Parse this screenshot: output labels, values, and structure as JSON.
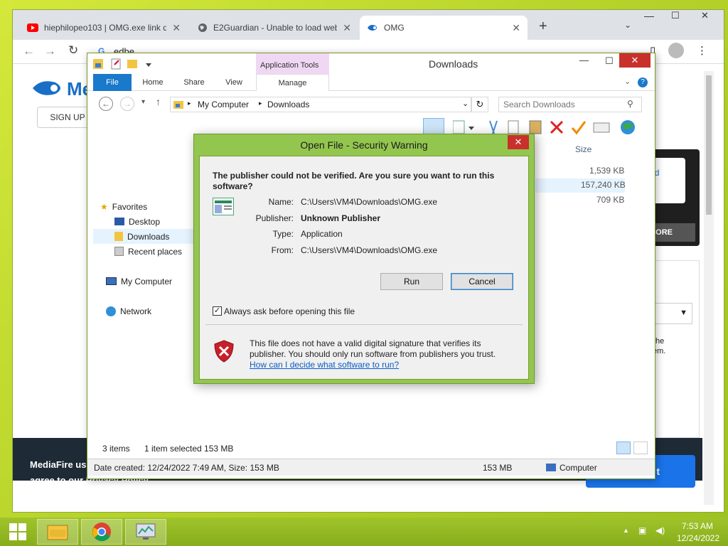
{
  "browser": {
    "tabs": [
      {
        "label": "hiephilopeo103 | OMG.exe link d",
        "icon": "youtube-icon"
      },
      {
        "label": "E2Guardian - Unable to load web",
        "icon": "globe-icon"
      },
      {
        "label": "OMG",
        "icon": "mediafire-icon"
      }
    ],
    "address": "edbe",
    "page": {
      "logo": "Me",
      "signup": "SIGN UP",
      "download_partial": "nload",
      "more_partial": "N MORE",
      "side_text_1": "he",
      "side_text_2": "em.",
      "cookie_text_1": "MediaFire use",
      "cookie_text_2": "agree to our Privacy Policy.",
      "cta_partial": "t"
    }
  },
  "explorer": {
    "title": "Downloads",
    "context_tab": "Application Tools",
    "tabs": [
      "File",
      "Home",
      "Share",
      "View",
      "Manage"
    ],
    "breadcrumb": [
      "My Computer",
      "Downloads"
    ],
    "search_placeholder": "Search Downloads",
    "column_size": "Size",
    "sizes": [
      "1,539 KB",
      "157,240 KB",
      "709 KB"
    ],
    "nav": {
      "favorites": "Favorites",
      "desktop": "Desktop",
      "downloads": "Downloads",
      "recent": "Recent places",
      "computer": "My Computer",
      "network": "Network"
    },
    "status": {
      "items": "3 items",
      "selected": "1 item selected  153 MB"
    },
    "details": {
      "created": "Date created: 12/24/2022 7:49 AM, Size: 153 MB",
      "size": "153 MB",
      "location": "Computer"
    }
  },
  "dialog": {
    "title": "Open File - Security Warning",
    "question": "The publisher could not be verified.  Are you sure you want to run this software?",
    "labels": {
      "name": "Name:",
      "publisher": "Publisher:",
      "type": "Type:",
      "from": "From:"
    },
    "values": {
      "name": "C:\\Users\\VM4\\Downloads\\OMG.exe",
      "publisher": "Unknown Publisher",
      "type": "Application",
      "from": "C:\\Users\\VM4\\Downloads\\OMG.exe"
    },
    "run": "Run",
    "cancel": "Cancel",
    "checkbox": "Always ask before opening this file",
    "checked": true,
    "warning": "This file does not have a valid digital signature that verifies its publisher.  You should only run software from publishers you trust.",
    "link": "How can I decide what software to run?"
  },
  "taskbar": {
    "time": "7:53 AM",
    "date": "12/24/2022"
  }
}
